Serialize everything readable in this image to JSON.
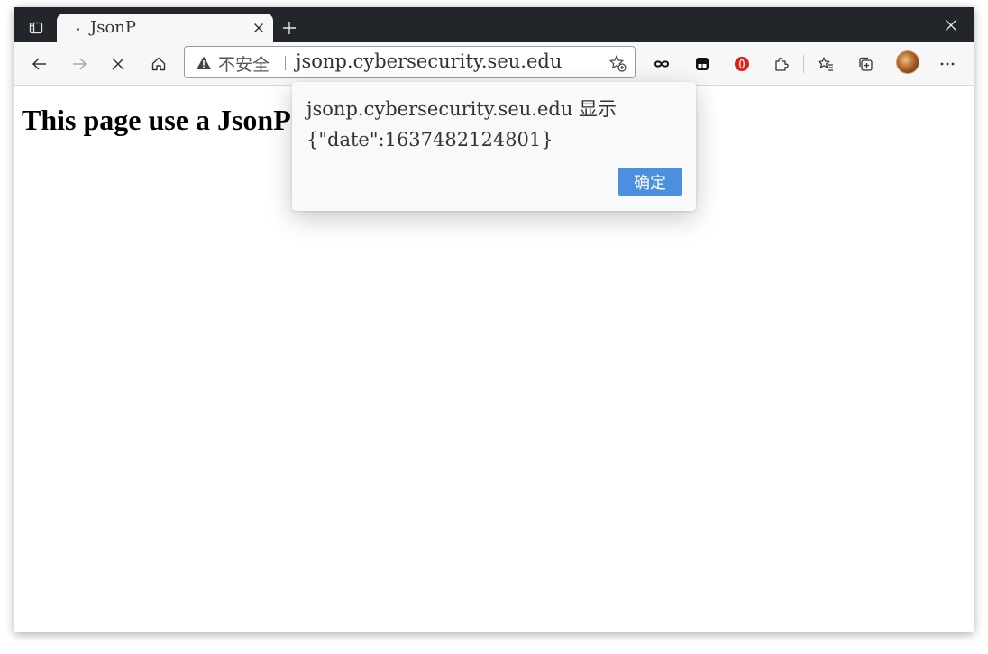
{
  "tab": {
    "title": "JsonP",
    "actions_icon": "tab-actions-icon",
    "close_icon": "close-icon",
    "new_tab_icon": "plus-icon"
  },
  "window": {
    "close_icon": "close-icon"
  },
  "toolbar": {
    "back_icon": "arrow-left-icon",
    "forward_icon": "arrow-right-icon",
    "stop_icon": "close-icon",
    "home_icon": "home-icon",
    "extensions": [
      "infinity-icon",
      "tab-extension-icon",
      "opera-icon",
      "puzzle-icon"
    ],
    "favorites_icon": "star-list-icon",
    "collections_icon": "collections-icon",
    "more_icon": "more-icon"
  },
  "address": {
    "security_label": "不安全",
    "url": "jsonp.cybersecurity.seu.edu",
    "warning_icon": "warning-icon",
    "add_favorite_icon": "star-add-icon"
  },
  "page": {
    "heading": "This page use a JsonP"
  },
  "dialog": {
    "title": "jsonp.cybersecurity.seu.edu  显示",
    "message": "{\"date\":1637482124801}",
    "ok_label": "确定"
  },
  "colors": {
    "tabstrip": "#22252a",
    "toolbar": "#f7f7f7",
    "dialog_button": "#4a8fe0",
    "opera_red": "#e0201c"
  }
}
